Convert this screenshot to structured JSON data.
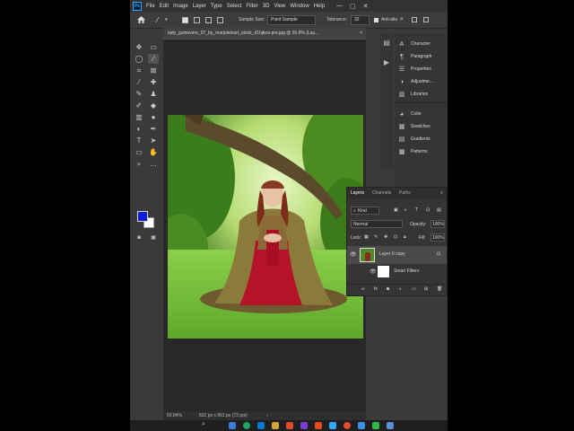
{
  "menu": {
    "items": [
      "File",
      "Edit",
      "Image",
      "Layer",
      "Type",
      "Select",
      "Filter",
      "3D",
      "View",
      "Window",
      "Help"
    ],
    "logo": "Ps",
    "minimize": "—",
    "restore": "▢",
    "close": "✕"
  },
  "options": {
    "sample_size_label": "Sample Size:",
    "sample_size_value": "Point Sample",
    "tolerance_label": "Tolerance:",
    "tolerance_value": "32",
    "anti_alias_label": "Anti-alia"
  },
  "document": {
    "tab_title": "lady_guinevere_07_by_marjoleinart_stock_d1hjkoa-pre.jpg @ 50.8% (Lay...",
    "tab_close": "×",
    "zoom": "50.84%",
    "dimensions": "832 px x 961 px (72 ppi)"
  },
  "panels": {
    "items": [
      {
        "label": "Character",
        "icon": "character-icon"
      },
      {
        "label": "Paragraph",
        "icon": "paragraph-icon"
      },
      {
        "label": "Properties",
        "icon": "properties-icon"
      },
      {
        "label": "Adjustme...",
        "icon": "adjustments-icon"
      },
      {
        "label": "Libraries",
        "icon": "libraries-icon"
      },
      {
        "label": "Color",
        "icon": "color-icon"
      },
      {
        "label": "Swatches",
        "icon": "swatches-icon"
      },
      {
        "label": "Gradients",
        "icon": "gradients-icon"
      },
      {
        "label": "Patterns",
        "icon": "patterns-icon"
      }
    ]
  },
  "layers": {
    "tabs": [
      "Layers",
      "Channels",
      "Paths"
    ],
    "filter_kind": "Kind",
    "blend_mode": "Normal",
    "opacity_label": "Opacity:",
    "opacity_value": "100%",
    "lock_label": "Lock:",
    "fill_label": "Fill:",
    "fill_value": "100%",
    "layer_name": "Layer 0 copy",
    "smart_filters_label": "Smart Filters"
  },
  "colors": {
    "foreground": "#0a1ed8",
    "background": "#ffffff",
    "accent": "#31a8ff"
  }
}
